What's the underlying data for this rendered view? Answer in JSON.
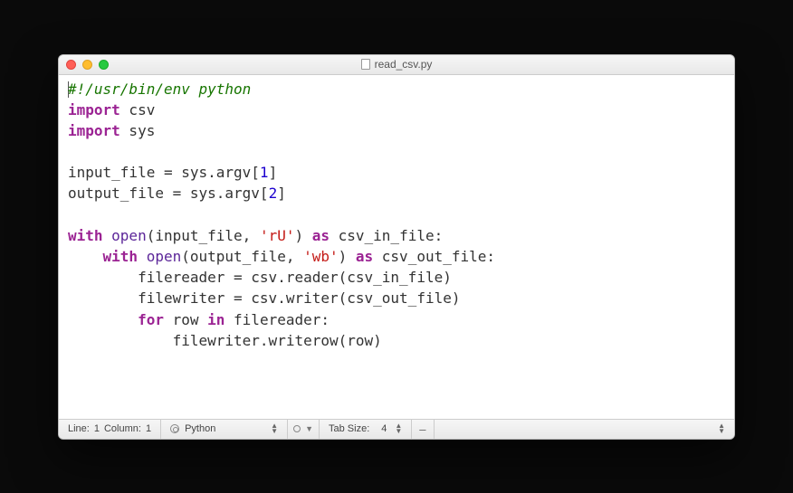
{
  "titlebar": {
    "filename": "read_csv.py"
  },
  "code": {
    "l1_shebang": "#!/usr/bin/env python",
    "l2_kw": "import",
    "l2_mod": " csv",
    "l3_kw": "import",
    "l3_mod": " sys",
    "l5_var": "input_file = sys.argv[",
    "l5_num": "1",
    "l5_end": "]",
    "l6_var": "output_file = sys.argv[",
    "l6_num": "2",
    "l6_end": "]",
    "l8_kw1": "with",
    "l8_fn": " open",
    "l8_p1": "(input_file, ",
    "l8_str": "'rU'",
    "l8_p2": ") ",
    "l8_kw2": "as",
    "l8_p3": " csv_in_file:",
    "l9_pad": "    ",
    "l9_kw1": "with",
    "l9_fn": " open",
    "l9_p1": "(output_file, ",
    "l9_str": "'wb'",
    "l9_p2": ") ",
    "l9_kw2": "as",
    "l9_p3": " csv_out_file:",
    "l10": "        filereader = csv.reader(csv_in_file)",
    "l11": "        filewriter = csv.writer(csv_out_file)",
    "l12_pad": "        ",
    "l12_kw1": "for",
    "l12_p1": " row ",
    "l12_kw2": "in",
    "l12_p2": " filereader:",
    "l13": "            filewriter.writerow(row)"
  },
  "status": {
    "line_label": "Line: ",
    "line": "1",
    "col_label": "  Column: ",
    "col": "1",
    "language": "Python",
    "tab_label": "Tab Size:",
    "tab_size": "4"
  }
}
